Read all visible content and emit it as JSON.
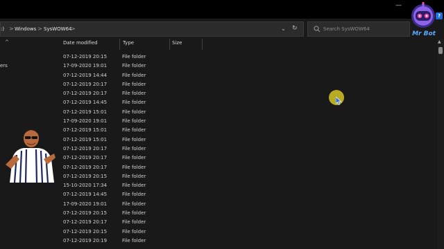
{
  "window": {
    "help_label": "?"
  },
  "address": {
    "drive_partial": ":)",
    "crumbs": [
      "Windows",
      "SysWOW64"
    ],
    "separator": ">"
  },
  "search": {
    "placeholder": "Search SysWOW64"
  },
  "nav": {
    "partial_label": "ers"
  },
  "columns": {
    "date": "Date modified",
    "type": "Type",
    "size": "Size"
  },
  "files": [
    {
      "date": "07-12-2019 20:15",
      "type": "File folder"
    },
    {
      "date": "17-09-2020 19:01",
      "type": "File folder"
    },
    {
      "date": "07-12-2019 14:44",
      "type": "File folder"
    },
    {
      "date": "07-12-2019 20:17",
      "type": "File folder"
    },
    {
      "date": "07-12-2019 20:17",
      "type": "File folder"
    },
    {
      "date": "07-12-2019 14:45",
      "type": "File folder"
    },
    {
      "date": "07-12-2019 15:01",
      "type": "File folder"
    },
    {
      "date": "17-09-2020 19:01",
      "type": "File folder"
    },
    {
      "date": "07-12-2019 15:01",
      "type": "File folder"
    },
    {
      "date": "07-12-2019 15:01",
      "type": "File folder"
    },
    {
      "date": "07-12-2019 20:17",
      "type": "File folder"
    },
    {
      "date": "07-12-2019 20:17",
      "type": "File folder"
    },
    {
      "date": "07-12-2019 20:17",
      "type": "File folder"
    },
    {
      "date": "07-12-2019 20:15",
      "type": "File folder"
    },
    {
      "date": "15-10-2020 17:34",
      "type": "File folder"
    },
    {
      "date": "07-12-2019 14:45",
      "type": "File folder"
    },
    {
      "date": "17-09-2020 19:01",
      "type": "File folder"
    },
    {
      "date": "07-12-2019 20:15",
      "type": "File folder"
    },
    {
      "date": "07-12-2019 20:17",
      "type": "File folder"
    },
    {
      "date": "07-12-2019 20:15",
      "type": "File folder"
    },
    {
      "date": "07-12-2019 20:19",
      "type": "File folder"
    }
  ],
  "overlay": {
    "brand": "Mr Bot",
    "logo_icon": "robot-mascot-icon",
    "presenter_icon": "presenter-cutout-icon"
  },
  "colors": {
    "background": "#191919",
    "bar": "#2b2b2b",
    "cursor_highlight": "#d6c428",
    "brand": "#5aa8ff"
  }
}
